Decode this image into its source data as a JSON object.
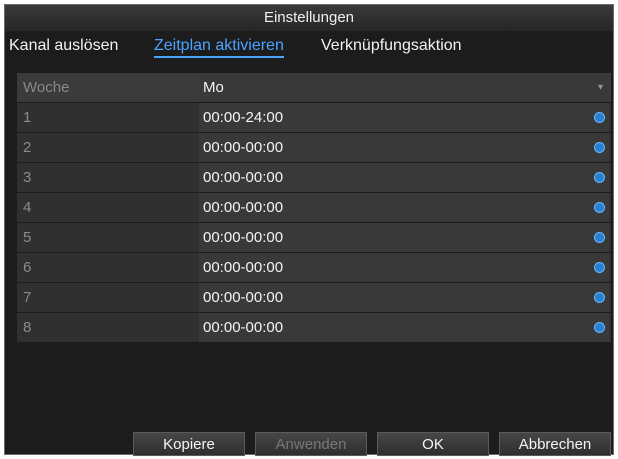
{
  "dialog": {
    "title": "Einstellungen",
    "tabs": [
      {
        "label": "Kanal auslösen"
      },
      {
        "label": "Zeitplan aktivieren"
      },
      {
        "label": "Verknüpfungsaktion"
      }
    ],
    "active_tab": "Zeitplan aktivieren"
  },
  "schedule": {
    "week_label": "Woche",
    "selected_day": "Mo",
    "rows": [
      {
        "label": "1",
        "value": "00:00-24:00"
      },
      {
        "label": "2",
        "value": "00:00-00:00"
      },
      {
        "label": "3",
        "value": "00:00-00:00"
      },
      {
        "label": "4",
        "value": "00:00-00:00"
      },
      {
        "label": "5",
        "value": "00:00-00:00"
      },
      {
        "label": "6",
        "value": "00:00-00:00"
      },
      {
        "label": "7",
        "value": "00:00-00:00"
      },
      {
        "label": "8",
        "value": "00:00-00:00"
      }
    ]
  },
  "buttons": {
    "copy": "Kopiere",
    "apply": "Anwenden",
    "ok": "OK",
    "cancel": "Abbrechen"
  },
  "colors": {
    "accent": "#4aa3ff",
    "background": "#1c1c1c",
    "dot": "#2b7fd0"
  }
}
